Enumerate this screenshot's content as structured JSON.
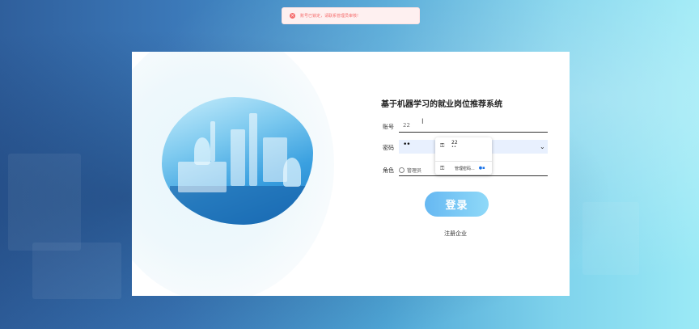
{
  "toast": {
    "icon": "error-circle-icon",
    "message": "账号已锁定，请联系管理员审核!"
  },
  "login": {
    "title": "基于机器学习的就业岗位推荐系统",
    "account_label": "账号",
    "account_value": "22",
    "password_label": "密码",
    "password_value": "••",
    "role_label": "角色",
    "role_option": "管理员",
    "submit_label": "登录",
    "register_link": "注册企业"
  },
  "autofill": {
    "username": "22",
    "password_mask": "••",
    "manage_label": "管理密码..."
  },
  "colors": {
    "accent": "#66b8f2",
    "error": "#f56c6c"
  }
}
